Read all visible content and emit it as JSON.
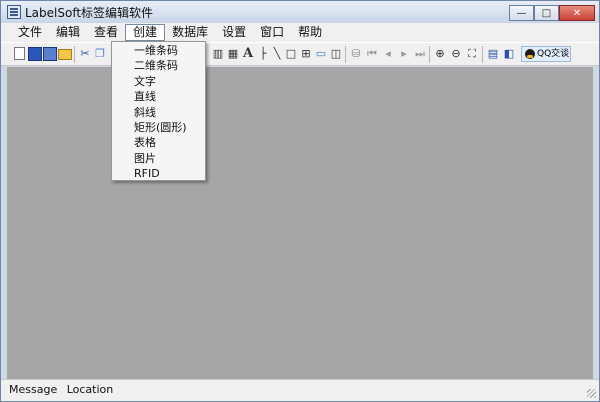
{
  "window": {
    "title": "LabelSoft标签编辑软件",
    "controls": {
      "minimize": "—",
      "maximize": "□",
      "close": "✕"
    }
  },
  "menu": {
    "items": [
      "文件",
      "编辑",
      "查看",
      "创建",
      "数据库",
      "设置",
      "窗口",
      "帮助"
    ],
    "active": "创建"
  },
  "create_menu": {
    "items": [
      "一维条码",
      "二维条码",
      "文字",
      "直线",
      "斜线",
      "矩形(圆形)",
      "表格",
      "图片",
      "RFID"
    ]
  },
  "toolbar": {
    "icons": [
      "new-icon",
      "save-icon",
      "save-as-icon",
      "open-folder-icon",
      "cut-icon",
      "copy-icon",
      "barcode-icon",
      "qrcode-icon",
      "text-icon",
      "line-icon",
      "diagonal-icon",
      "rectangle-icon",
      "table-icon",
      "image-icon",
      "rfid-icon",
      "database-icon",
      "first-record-icon",
      "prev-record-icon",
      "next-record-icon",
      "last-record-icon",
      "zoom-in-icon",
      "zoom-out-icon",
      "fit-icon",
      "layout-horizontal-icon",
      "layout-vertical-icon"
    ],
    "text_icon_glyph": "A",
    "qq_label": "QQ交谈"
  },
  "status": {
    "message": "Message",
    "location": "Location"
  },
  "colors": {
    "workspace": "#a6a6a6",
    "chrome": "#f0f0f0",
    "close_button": "#c84034"
  }
}
